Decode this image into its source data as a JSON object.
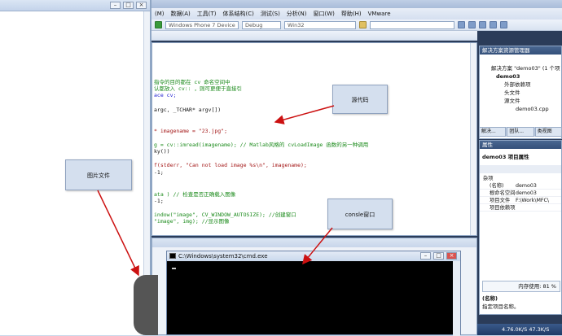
{
  "menu": {
    "items": [
      "(M)",
      "数据(A)",
      "工具(T)",
      "体系结构(C)",
      "测试(S)",
      "分析(N)",
      "窗口(W)",
      "帮助(H)",
      "VMware"
    ]
  },
  "toolbar": {
    "device": "Windows Phone 7 Device",
    "config": "Debug",
    "platform": "Win32"
  },
  "code": {
    "l1": "指令的目的都在 cv 命名空间中",
    "l2": "认都放入 cv:: ，则可更便于直接引",
    "l3": "ace cv;",
    "l4": "argc, _TCHAR* argv[])",
    "l5": "* imagename = \"23.jpg\";",
    "l6": "g = cv::imread(imagename); // Matlab风格的 cvLoadImage 函数的另一种调用",
    "l7": "ky())",
    "l8": "f(stderr, \"Can not load image %s\\n\", imagename);",
    "l9": "-1;",
    "l10": "ata ) // 检查是否正确载入图像",
    "l11": "-1;",
    "l12": "indow(\"image\", CV_WINDOW_AUTOSIZE); //创建窗口",
    "l13": "\"image\", img); //显示图像"
  },
  "solution": {
    "title": "解决方案资源管理器",
    "root": "解决方案 \"demo03\" (1 个项",
    "project": "demo03",
    "items": [
      "外部依赖项",
      "头文件",
      "源文件",
      "demo03.cpp"
    ]
  },
  "tabs": [
    "解决...",
    "团队...",
    "类视图"
  ],
  "properties": {
    "header": "属性",
    "title": "demo03 项目属性",
    "group": "杂项",
    "rows": [
      {
        "k": "(名称)",
        "v": "demo03"
      },
      {
        "k": "根命名空间",
        "v": "demo03"
      },
      {
        "k": "项目文件",
        "v": "F:\\Work\\MFC\\"
      },
      {
        "k": "项目依赖项",
        "v": ""
      }
    ],
    "desc_title": "(名称)",
    "desc_text": "指定项目名称。"
  },
  "memory": "内存使用: 81 %",
  "taskbar": "4.76.0K/S 47.3K/S",
  "console": {
    "title": "C:\\Windows\\system32\\cmd.exe"
  },
  "callouts": {
    "source": "源代码",
    "image": "图片文件",
    "console": "consle窗口"
  },
  "colors": {
    "arrow": "#cc1111"
  }
}
